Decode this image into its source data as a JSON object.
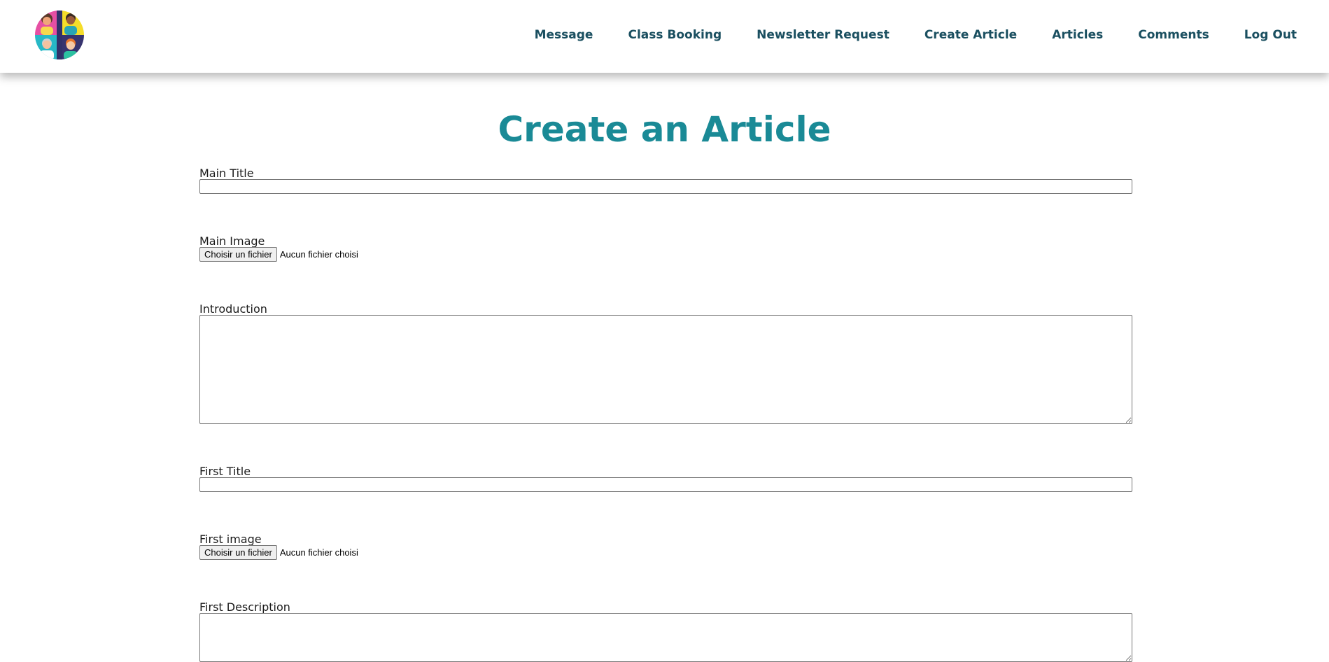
{
  "header": {
    "logo_icon": "people-group-icon",
    "nav": [
      {
        "label": "Message"
      },
      {
        "label": "Class Booking"
      },
      {
        "label": "Newsletter Request"
      },
      {
        "label": "Create Article"
      },
      {
        "label": "Articles"
      },
      {
        "label": "Comments"
      },
      {
        "label": "Log Out"
      }
    ]
  },
  "page": {
    "title": "Create an Article",
    "title_color": "#1a8a96",
    "nav_color": "#1a4f60"
  },
  "form": {
    "main_title": {
      "label": "Main Title",
      "value": ""
    },
    "main_image": {
      "label": "Main Image",
      "button": "Choisir un fichier",
      "status": "Aucun fichier choisi"
    },
    "introduction": {
      "label": "Introduction",
      "value": ""
    },
    "first_title": {
      "label": "First Title",
      "value": ""
    },
    "first_image": {
      "label": "First image",
      "button": "Choisir un fichier",
      "status": "Aucun fichier choisi"
    },
    "first_description": {
      "label": "First Description",
      "value": ""
    }
  }
}
